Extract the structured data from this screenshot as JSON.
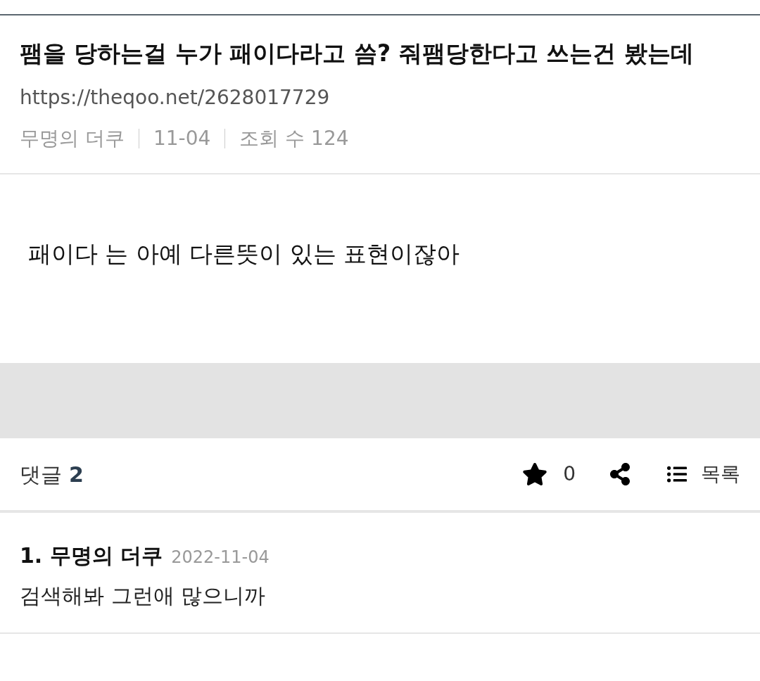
{
  "post": {
    "title": "팸을 당하는걸 누가 패이다라고 씀? 줘팸당한다고 쓰는건 봤는데",
    "url": "https://theqoo.net/2628017729",
    "author": "무명의 더쿠",
    "date": "11-04",
    "views": "조회 수 124",
    "body": "패이다 는 아예 다른뜻이 있는 표현이잖아"
  },
  "comment_bar": {
    "label": "댓글",
    "count": "2",
    "stars": "0",
    "list_label": "목록"
  },
  "comments": [
    {
      "number": "1.",
      "author": "무명의 더쿠",
      "date": "2022-11-04",
      "text": "검색해봐 그런애 많으니까"
    }
  ]
}
